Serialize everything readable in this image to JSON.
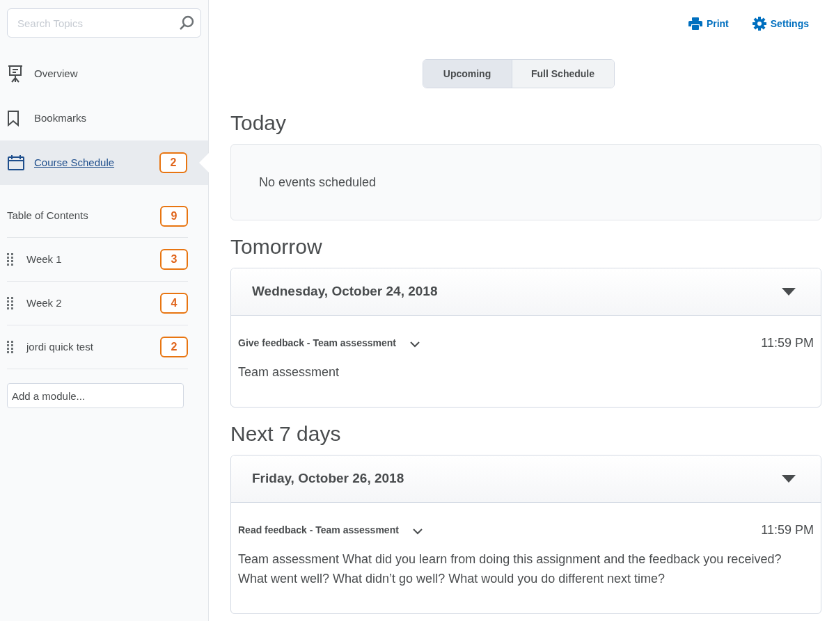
{
  "sidebar": {
    "search": {
      "placeholder": "Search Topics"
    },
    "nav": [
      {
        "label": "Overview",
        "selected": false
      },
      {
        "label": "Bookmarks",
        "selected": false
      },
      {
        "label": "Course Schedule",
        "selected": true,
        "badge": "2"
      }
    ],
    "toc": {
      "label": "Table of Contents",
      "badge": "9"
    },
    "modules": [
      {
        "label": "Week 1",
        "badge": "3"
      },
      {
        "label": "Week 2",
        "badge": "4"
      },
      {
        "label": "jordi quick test",
        "badge": "2"
      }
    ],
    "add_module": {
      "placeholder": "Add a module..."
    }
  },
  "actions": [
    {
      "label": "Print"
    },
    {
      "label": "Settings"
    }
  ],
  "tabs": [
    {
      "label": "Upcoming",
      "selected": true
    },
    {
      "label": "Full Schedule",
      "selected": false
    }
  ],
  "sections": [
    {
      "heading": "Today",
      "empty_text": "No events scheduled"
    },
    {
      "heading": "Tomorrow",
      "days": [
        {
          "date": "Wednesday, October 24, 2018",
          "events": [
            {
              "title": "Give feedback - Team assessment",
              "time": "11:59 PM",
              "description": "Team assessment"
            }
          ]
        }
      ]
    },
    {
      "heading": "Next 7 days",
      "days": [
        {
          "date": "Friday, October 26, 2018",
          "events": [
            {
              "title": "Read feedback - Team assessment",
              "time": "11:59 PM",
              "description": "Team assessment What did you learn from doing this assignment and the feedback you received? What went well? What didn’t go well? What would you do different next time?"
            }
          ]
        }
      ]
    }
  ]
}
